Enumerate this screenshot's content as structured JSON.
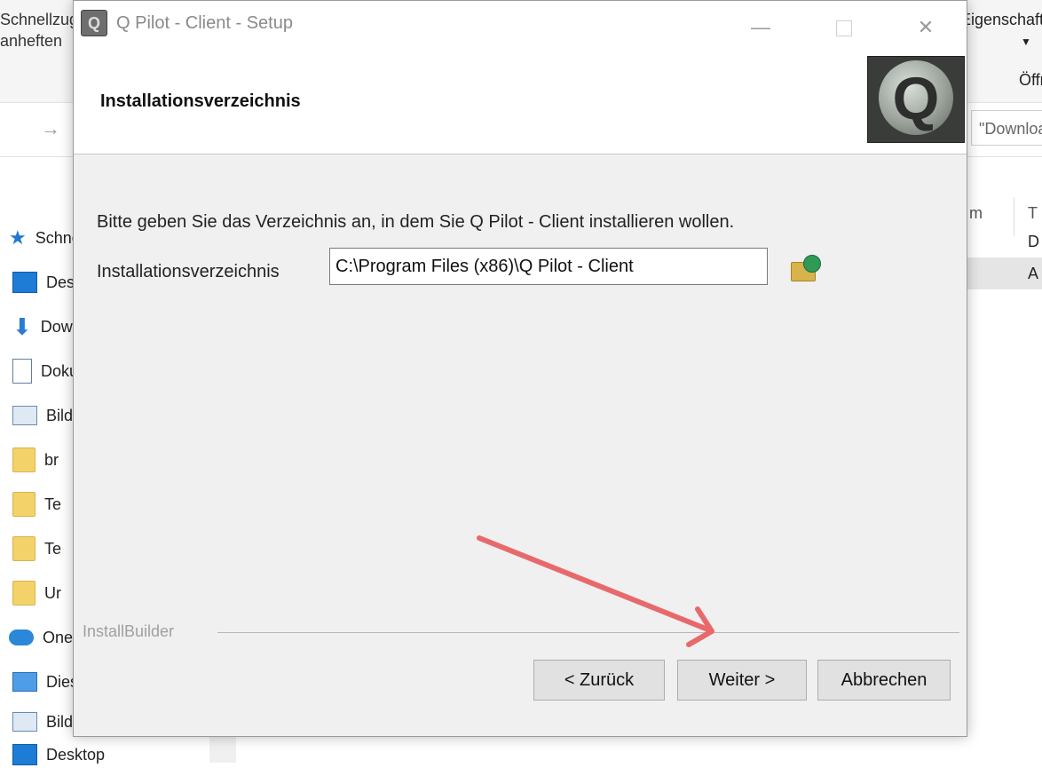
{
  "explorer": {
    "ribbon_left_top": "Schnellzugriff",
    "ribbon_left_bottom": "anheften",
    "ribbon_right_top": "Eigenschaften",
    "ribbon_right_open": "Öffnen",
    "address_box": "\"Downloads\"",
    "column_header_m": "m",
    "column_header_t": "T",
    "row_letters": [
      "D",
      "A"
    ],
    "nav_items": [
      {
        "label": "Schnellzugriff",
        "icon": "star-icon"
      },
      {
        "label": "Desktop",
        "icon": "desktop-icon"
      },
      {
        "label": "Downloads",
        "icon": "download-arrow-icon"
      },
      {
        "label": "Dokumente",
        "icon": "document-icon"
      },
      {
        "label": "Bilder",
        "icon": "pictures-icon"
      },
      {
        "label": "br",
        "icon": "folder-icon"
      },
      {
        "label": "Te",
        "icon": "folder-icon"
      },
      {
        "label": "Te",
        "icon": "folder-icon"
      },
      {
        "label": "Ur",
        "icon": "folder-icon"
      },
      {
        "label": "OneDrive",
        "icon": "onedrive-cloud-icon"
      },
      {
        "label": "Dieser PC",
        "icon": "this-pc-icon"
      },
      {
        "label": "Bilder",
        "icon": "pictures-icon"
      },
      {
        "label": "Desktop",
        "icon": "desktop-icon"
      }
    ]
  },
  "dialog": {
    "title": "Q Pilot - Client - Setup",
    "app_icon_letter": "Q",
    "minimize_glyph": "—",
    "close_glyph": "✕",
    "header_title": "Installationsverzeichnis",
    "logo_letter": "Q",
    "description": "Bitte geben Sie das Verzeichnis an, in dem Sie Q Pilot - Client installieren wollen.",
    "field_label": "Installationsverzeichnis",
    "install_path": "C:\\Program Files (x86)\\Q Pilot - Client",
    "footer_brand": "InstallBuilder",
    "buttons": {
      "back": "< Zurück",
      "next": "Weiter >",
      "cancel": "Abbrechen"
    }
  },
  "colors": {
    "annotation_arrow": "#e8696b",
    "dialog_bg": "#f0f0f0"
  }
}
